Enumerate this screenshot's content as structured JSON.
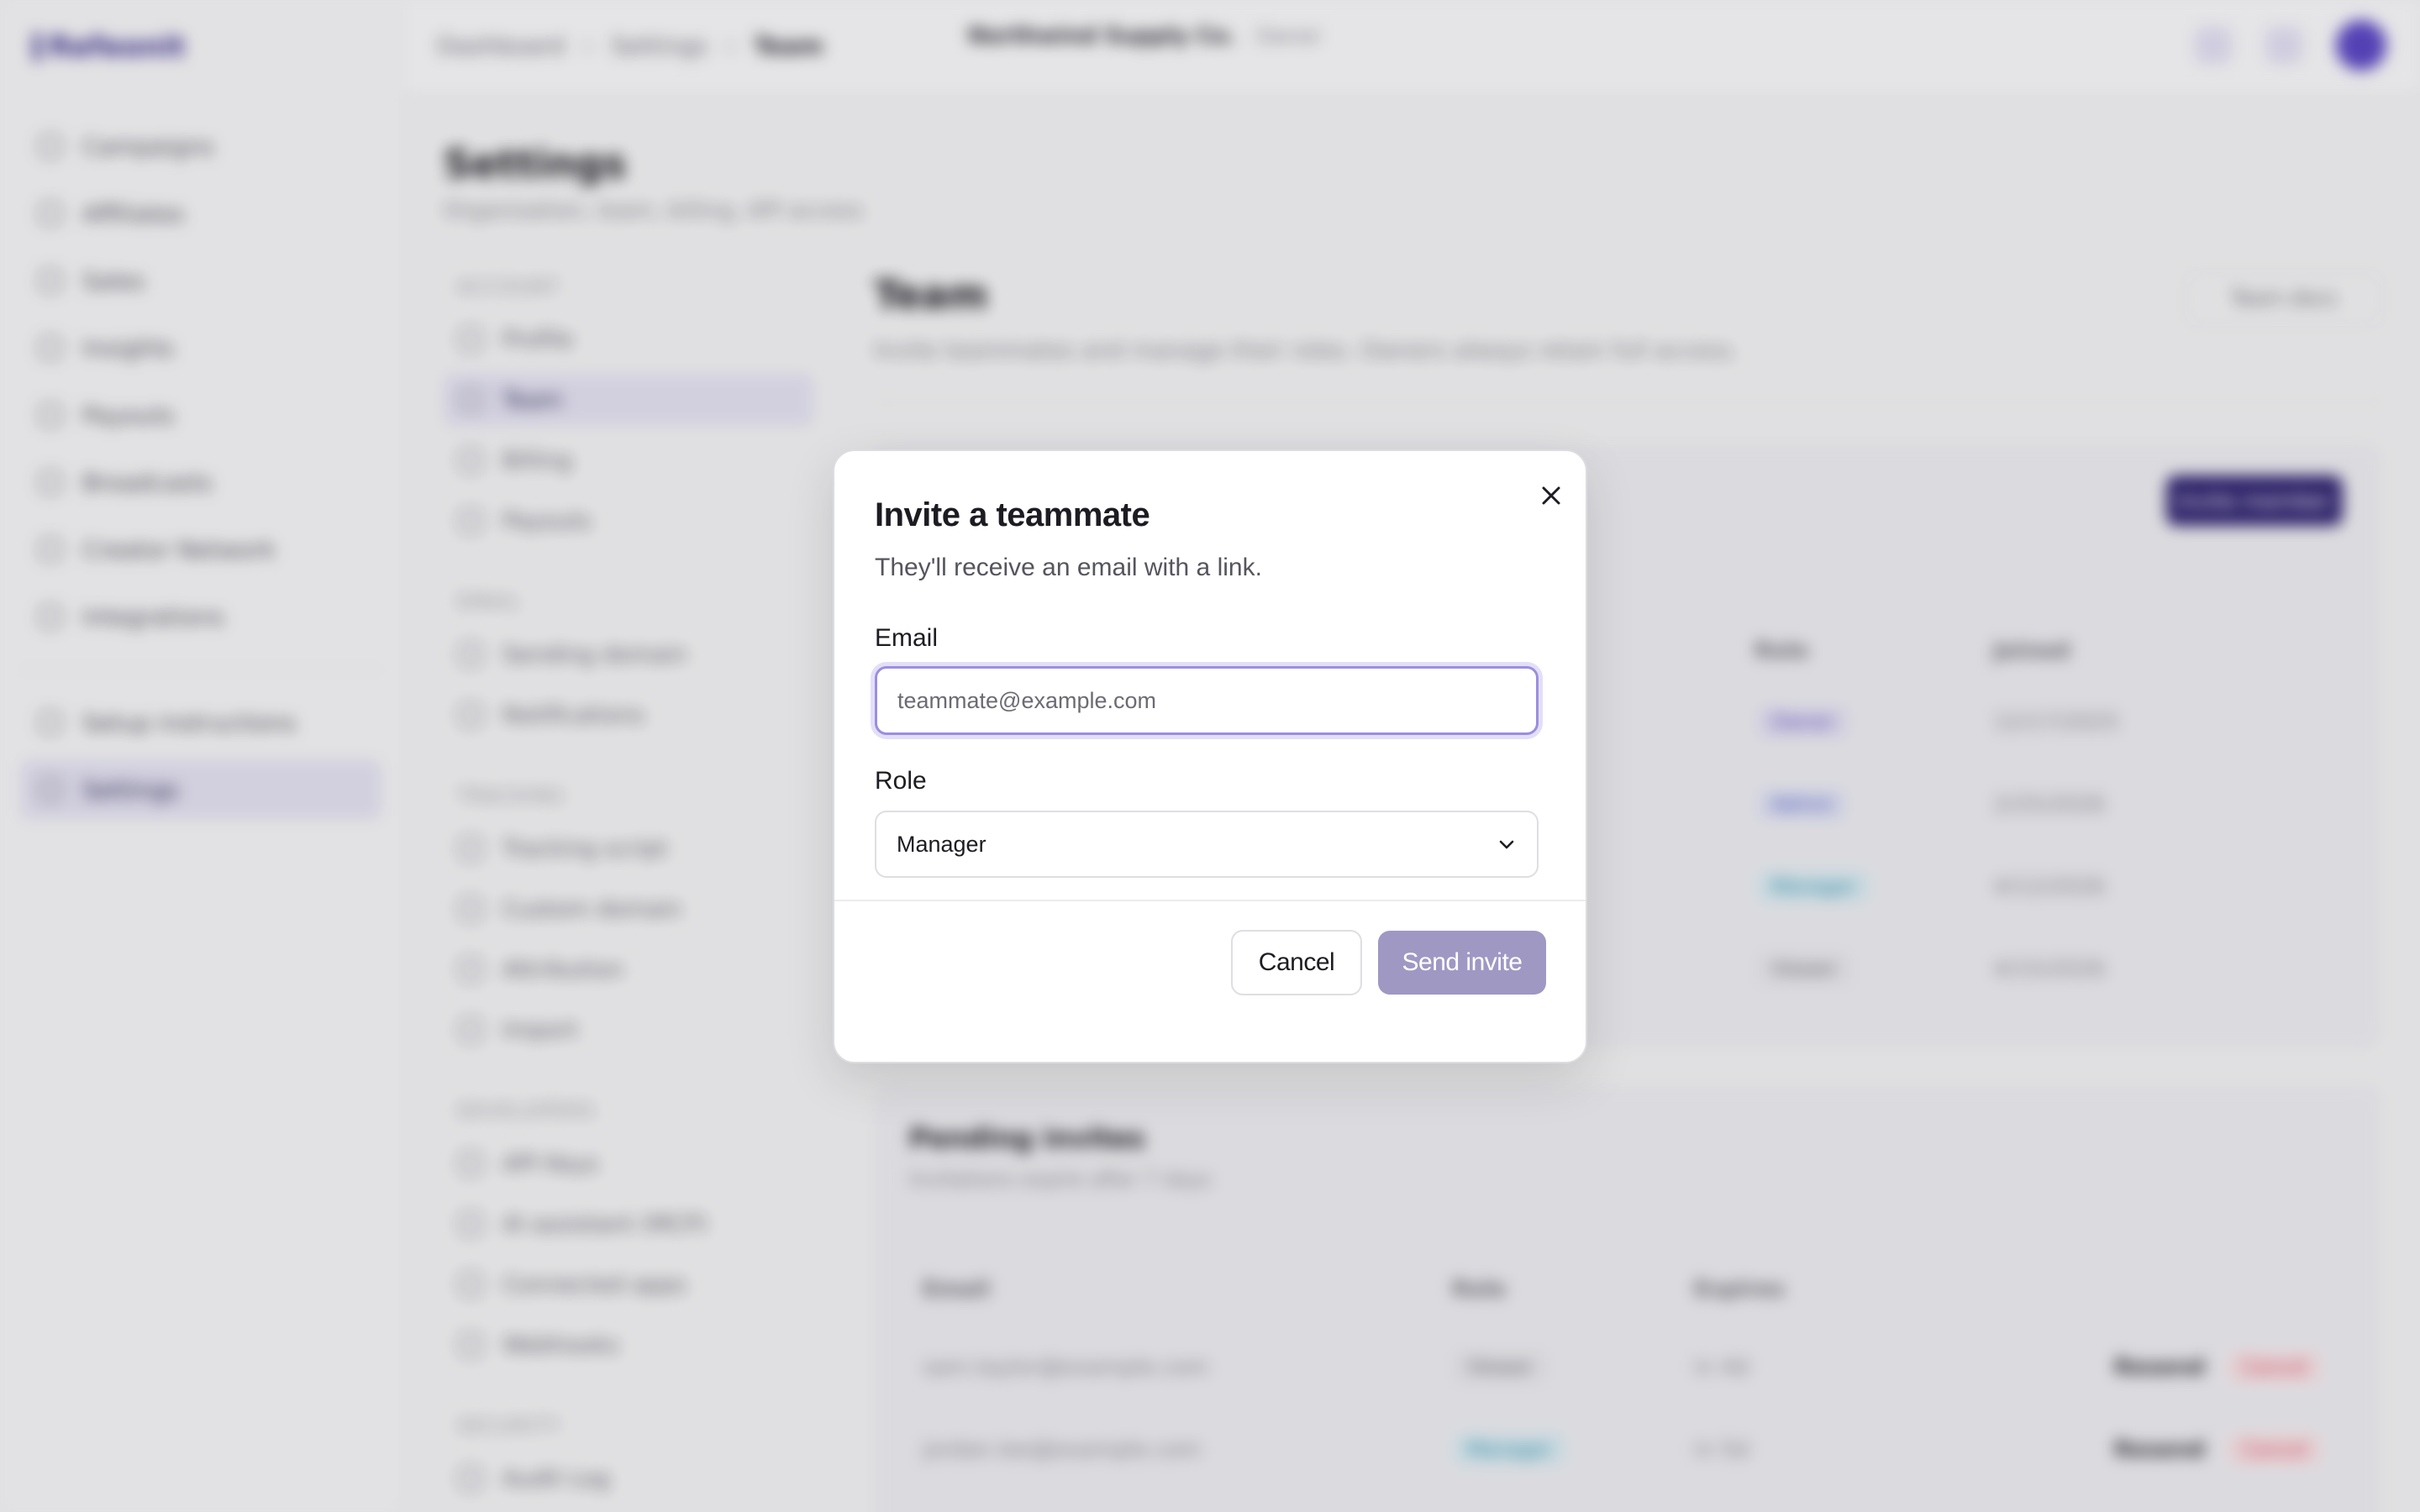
{
  "app": {
    "logo_text": "Refeonit",
    "sidebar": {
      "items": [
        {
          "label": "Campaigns",
          "icon": "grid-icon"
        },
        {
          "label": "Affiliates",
          "icon": "users-icon"
        },
        {
          "label": "Sales",
          "icon": "receipt-icon"
        },
        {
          "label": "Insights",
          "icon": "chart-icon"
        },
        {
          "label": "Payouts",
          "icon": "wallet-icon"
        },
        {
          "label": "Broadcasts",
          "icon": "mail-icon"
        },
        {
          "label": "Creator Network",
          "icon": "globe-icon"
        },
        {
          "label": "Integrations",
          "icon": "plug-icon"
        }
      ],
      "bottom_items": [
        {
          "label": "Setup instructions",
          "icon": "wand-icon"
        },
        {
          "label": "Settings",
          "icon": "gear-icon"
        }
      ]
    },
    "breadcrumb": {
      "items": [
        "Dashboard",
        "Settings",
        "Team"
      ]
    },
    "org": {
      "name": "Northwind Supply Co.",
      "role": "Owner"
    },
    "page": {
      "title": "Settings",
      "subtitle": "Organization, team, billing, API access"
    },
    "subnav": {
      "sections": [
        {
          "heading": "ACCOUNT",
          "items": [
            "Profile",
            "Team",
            "Billing",
            "Payouts"
          ]
        },
        {
          "heading": "EMAIL",
          "items": [
            "Sending domain",
            "Notifications"
          ]
        },
        {
          "heading": "TRACKING",
          "items": [
            "Tracking script",
            "Custom domain",
            "Attribution",
            "Import"
          ]
        },
        {
          "heading": "DEVELOPERS",
          "items": [
            "API Keys",
            "AI assistant (MCP)",
            "Connected apps",
            "Webhooks"
          ]
        },
        {
          "heading": "SECURITY",
          "items": [
            "Audit Log"
          ]
        }
      ]
    },
    "team": {
      "title": "Team",
      "subtitle": "Invite teammates and manage their roles. Owners always retain full access.",
      "docs_label": "Team docs",
      "invite_button": "Invite member",
      "columns": [
        "Role",
        "Joined"
      ],
      "rows": [
        {
          "role": "Owner",
          "joined": "12/17/2025"
        },
        {
          "role": "Admin",
          "joined": "2/25/2026"
        },
        {
          "role": "Manager",
          "joined": "4/12/2026"
        },
        {
          "role": "Viewer",
          "joined": "4/15/2026"
        }
      ]
    },
    "pending": {
      "title": "Pending invites",
      "subtitle": "Invitations expire after 7 days",
      "columns": [
        "Email",
        "Role",
        "Expires"
      ],
      "rows": [
        {
          "email": "sam.taylor@example.com",
          "role": "Viewer",
          "expires": "in 4d",
          "resend": "Resend",
          "cancel": "Cancel"
        },
        {
          "email": "jordan.lee@example.com",
          "role": "Manager",
          "expires": "in 5d",
          "resend": "Resend",
          "cancel": "Cancel"
        }
      ]
    }
  },
  "modal": {
    "title": "Invite a teammate",
    "subtitle": "They'll receive an email with a link.",
    "email_label": "Email",
    "email_placeholder": "teammate@example.com",
    "email_value": "",
    "role_label": "Role",
    "role_value": "Manager",
    "cancel_label": "Cancel",
    "send_label": "Send invite"
  },
  "colors": {
    "accent": "#2f2370",
    "send_disabled": "#9f98c3",
    "focus_ring": "#9b8ee0"
  }
}
